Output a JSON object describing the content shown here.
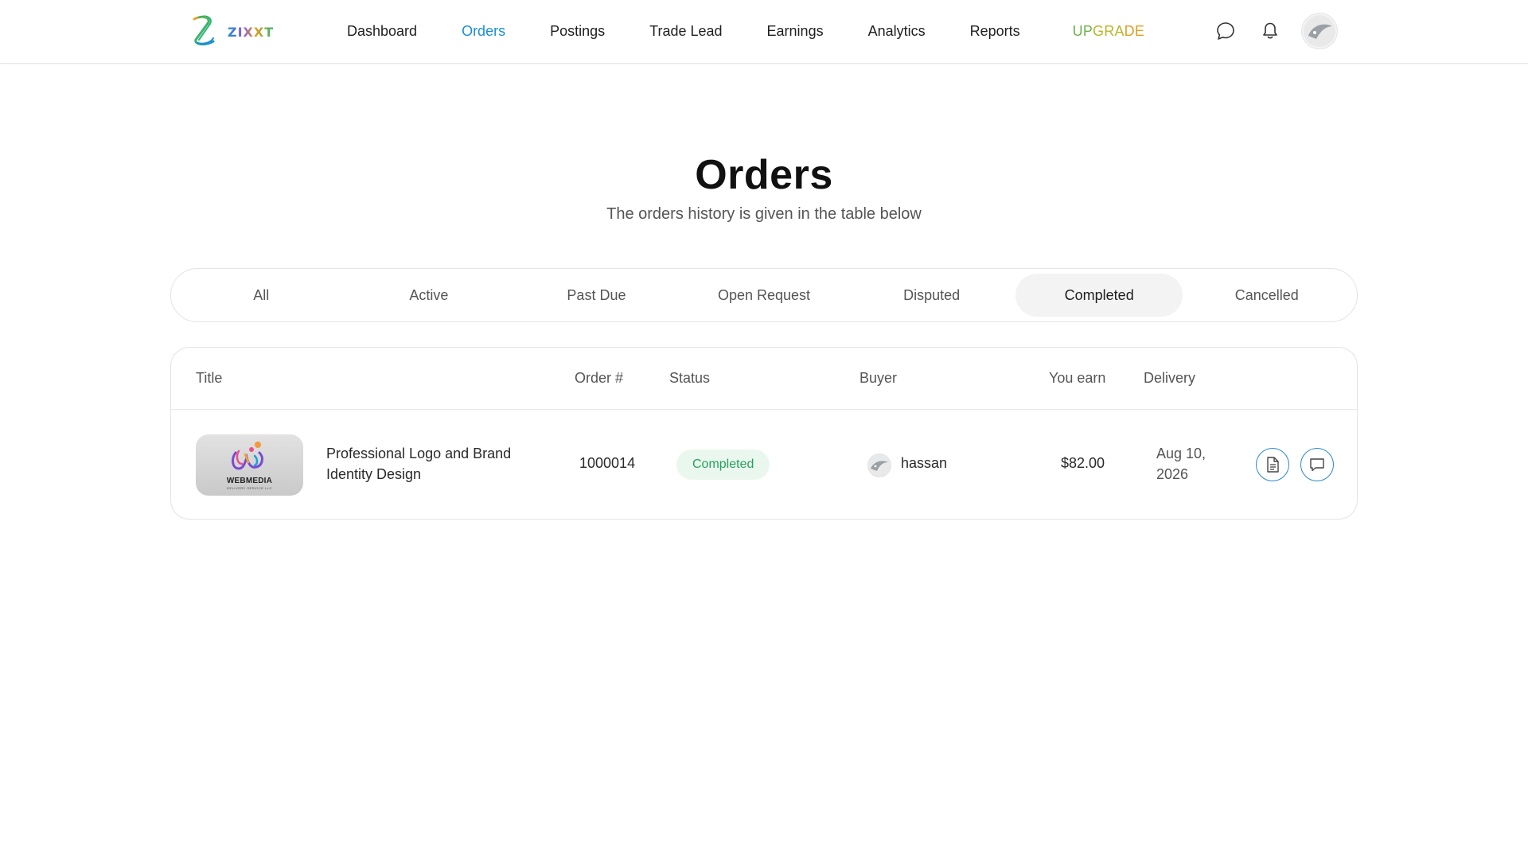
{
  "brand": {
    "logo_text": "ZIXXT"
  },
  "nav": {
    "items": [
      {
        "label": "Dashboard"
      },
      {
        "label": "Orders"
      },
      {
        "label": "Postings"
      },
      {
        "label": "Trade Lead"
      },
      {
        "label": "Earnings"
      },
      {
        "label": "Analytics"
      },
      {
        "label": "Reports"
      }
    ],
    "upgrade": {
      "part1": "UP",
      "part2": "GRA",
      "part3": "DE"
    },
    "active_item": "Orders",
    "icons": [
      "chat-bubble-icon",
      "bell-icon",
      "avatar"
    ]
  },
  "header": {
    "title": "Orders",
    "subtitle": "The orders history is given in the table below"
  },
  "tabs": {
    "items": [
      {
        "label": "All"
      },
      {
        "label": "Active"
      },
      {
        "label": "Past Due"
      },
      {
        "label": "Open Request"
      },
      {
        "label": "Disputed"
      },
      {
        "label": "Completed"
      },
      {
        "label": "Cancelled"
      }
    ],
    "selected": "Completed"
  },
  "table": {
    "columns": {
      "title": "Title",
      "order": "Order #",
      "status": "Status",
      "buyer": "Buyer",
      "earn": "You earn",
      "delivery": "Delivery"
    },
    "rows": [
      {
        "thumb_text": "WEBMEDIA",
        "thumb_subtext": "DELIVERY SERVICE LLC",
        "title_line1": "Professional Logo and Brand",
        "title_line2": "Identity Design",
        "order_number": "1000014",
        "status": "Completed",
        "buyer": "hassan",
        "earn": "$82.00",
        "delivery_line1": "Aug 10,",
        "delivery_line2": "2026",
        "actions": [
          "document-icon",
          "message-icon"
        ]
      }
    ]
  },
  "colors": {
    "accent": "#1a8fd6",
    "status_green": "#25a15b",
    "status_green_bg": "#eaf7ef",
    "action_border": "#2a88c7"
  }
}
